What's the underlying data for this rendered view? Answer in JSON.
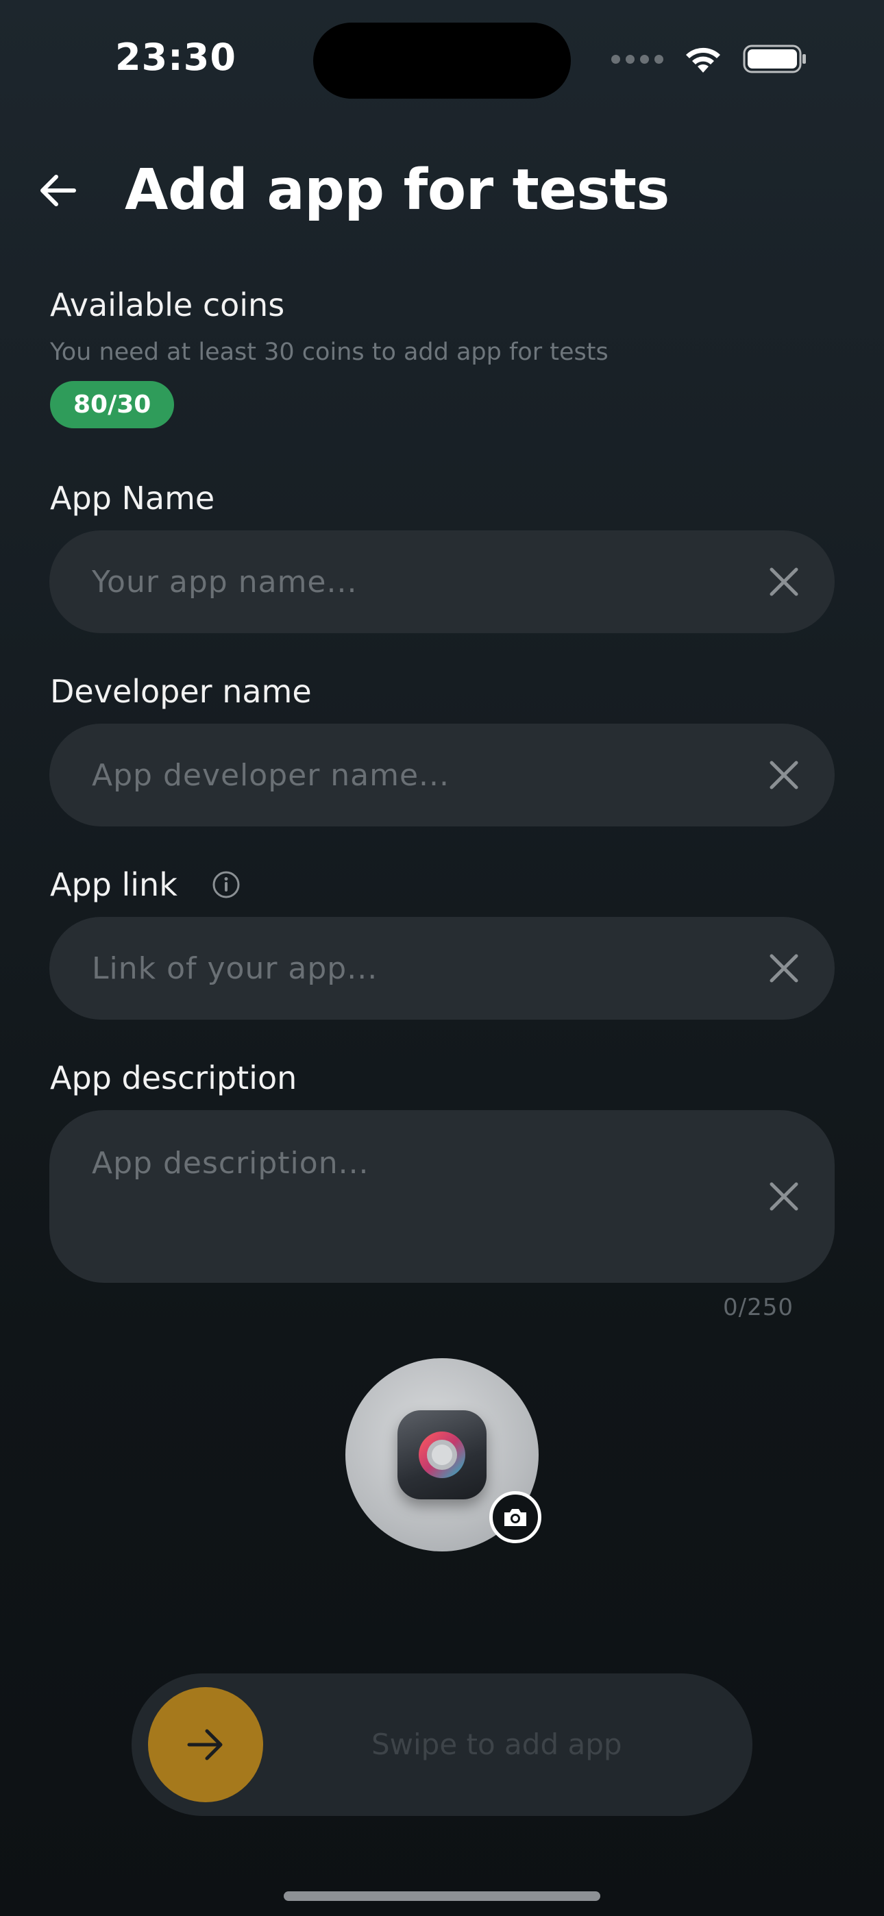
{
  "status_bar": {
    "time": "23:30"
  },
  "header": {
    "title": "Add app for tests"
  },
  "coins": {
    "title": "Available coins",
    "subtitle": "You need at least 30 coins to add app for tests",
    "badge": "80/30",
    "badge_color": "#2f9c5a"
  },
  "fields": {
    "app_name": {
      "label": "App Name",
      "placeholder": "Your app name...",
      "value": ""
    },
    "developer_name": {
      "label": "Developer name",
      "placeholder": "App developer name...",
      "value": ""
    },
    "app_link": {
      "label": "App link",
      "placeholder": "Link of your app...",
      "value": ""
    },
    "app_description": {
      "label": "App description",
      "placeholder": "App description...",
      "value": "",
      "counter": "0/250"
    }
  },
  "swipe": {
    "label": "Swipe to add app",
    "accent_color": "#a6791c"
  },
  "icons": [
    "back-arrow-icon",
    "info-icon",
    "close-icon",
    "camera-icon",
    "arrow-right-icon",
    "wifi-icon",
    "battery-icon"
  ]
}
